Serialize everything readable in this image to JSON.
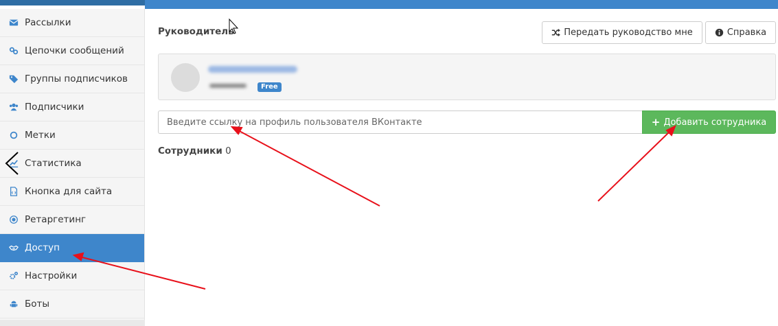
{
  "sidebar": {
    "items": [
      {
        "label": "Рассылки",
        "icon": "envelope-icon"
      },
      {
        "label": "Цепочки сообщений",
        "icon": "link-icon"
      },
      {
        "label": "Группы подписчиков",
        "icon": "tag-icon"
      },
      {
        "label": "Подписчики",
        "icon": "users-icon"
      },
      {
        "label": "Метки",
        "icon": "circle-icon"
      },
      {
        "label": "Статистика",
        "icon": "chart-line-icon"
      },
      {
        "label": "Кнопка для сайта",
        "icon": "file-code-icon"
      },
      {
        "label": "Ретаргетинг",
        "icon": "target-icon"
      },
      {
        "label": "Доступ",
        "icon": "handshake-icon",
        "active": true
      },
      {
        "label": "Настройки",
        "icon": "cogs-icon"
      },
      {
        "label": "Боты",
        "icon": "android-icon"
      }
    ]
  },
  "main": {
    "leader_title": "Руководитель",
    "transfer_button": "Передать руководство мне",
    "help_button": "Справка",
    "owner_badge": "Free",
    "profile_input_placeholder": "Введите ссылку на профиль пользователя ВКонтакте",
    "add_employee_button": "Добавить сотрудника",
    "employees_label": "Сотрудники",
    "employees_count": "0"
  },
  "colors": {
    "accent": "#3e86cb",
    "success": "#5cb85c",
    "annotation_arrow": "#e8101a"
  }
}
